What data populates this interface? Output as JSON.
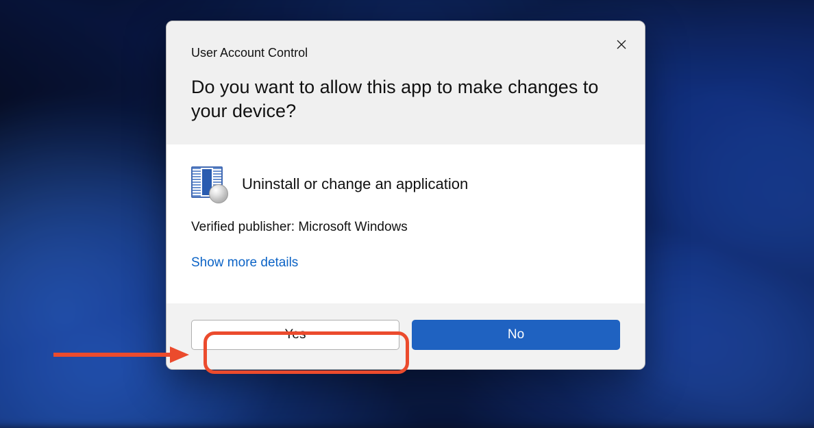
{
  "dialog": {
    "title": "User Account Control",
    "prompt": "Do you want to allow this app to make changes to your device?",
    "app_name": "Uninstall or change an application",
    "publisher_line": "Verified publisher: Microsoft Windows",
    "details_link": "Show more details",
    "yes_label": "Yes",
    "no_label": "No",
    "close_icon": "close",
    "app_icon": "programs-and-features-icon"
  },
  "annotation": {
    "highlight_target": "yes-button",
    "arrow_color": "#eb4b2d"
  }
}
